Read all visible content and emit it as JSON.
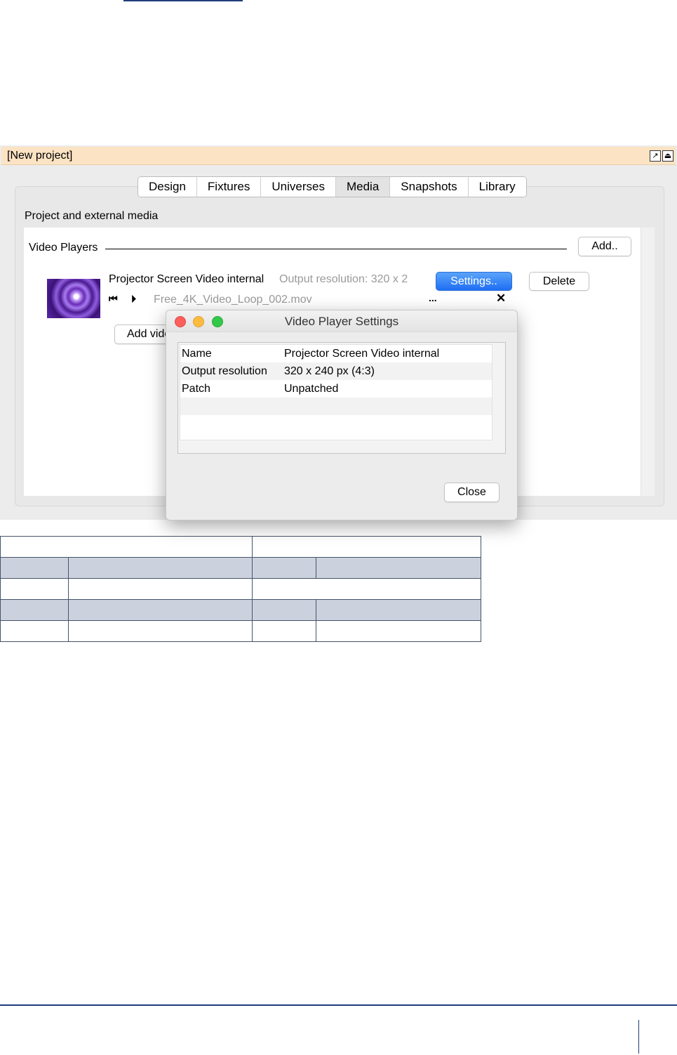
{
  "window": {
    "title": "[New project]"
  },
  "tabs": [
    "Design",
    "Fixtures",
    "Universes",
    "Media",
    "Snapshots",
    "Library"
  ],
  "active_tab": "Media",
  "section": {
    "title": "Project and external media",
    "video_players_label": "Video Players",
    "add_button": "Add.."
  },
  "player": {
    "name": "Projector Screen Video internal",
    "resolution_text": "Output resolution: 320 x 2",
    "settings_button": "Settings..",
    "delete_button": "Delete",
    "file_name": "Free_4K_Video_Loop_002.mov",
    "more_label": "...",
    "remove_label": "✕",
    "rewind_icon": "⏮",
    "play_icon": "⏵",
    "add_video_button": "Add video"
  },
  "dialog": {
    "title": "Video Player Settings",
    "rows": [
      {
        "key": "Name",
        "value": "Projector Screen Video internal"
      },
      {
        "key": "Output resolution",
        "value": "320 x 240 px (4:3)"
      },
      {
        "key": "Patch",
        "value": "Unpatched"
      }
    ],
    "close_button": "Close"
  },
  "colors": {
    "titlebar_bg": "#fbe3c3",
    "accent_blue": "#1f6ff3",
    "close_dot": "#fc605c",
    "minimize_dot": "#fdbc40",
    "zoom_dot": "#34c84a",
    "doc_rule": "#1f3d7a",
    "table_shade": "#ccd2dd"
  }
}
